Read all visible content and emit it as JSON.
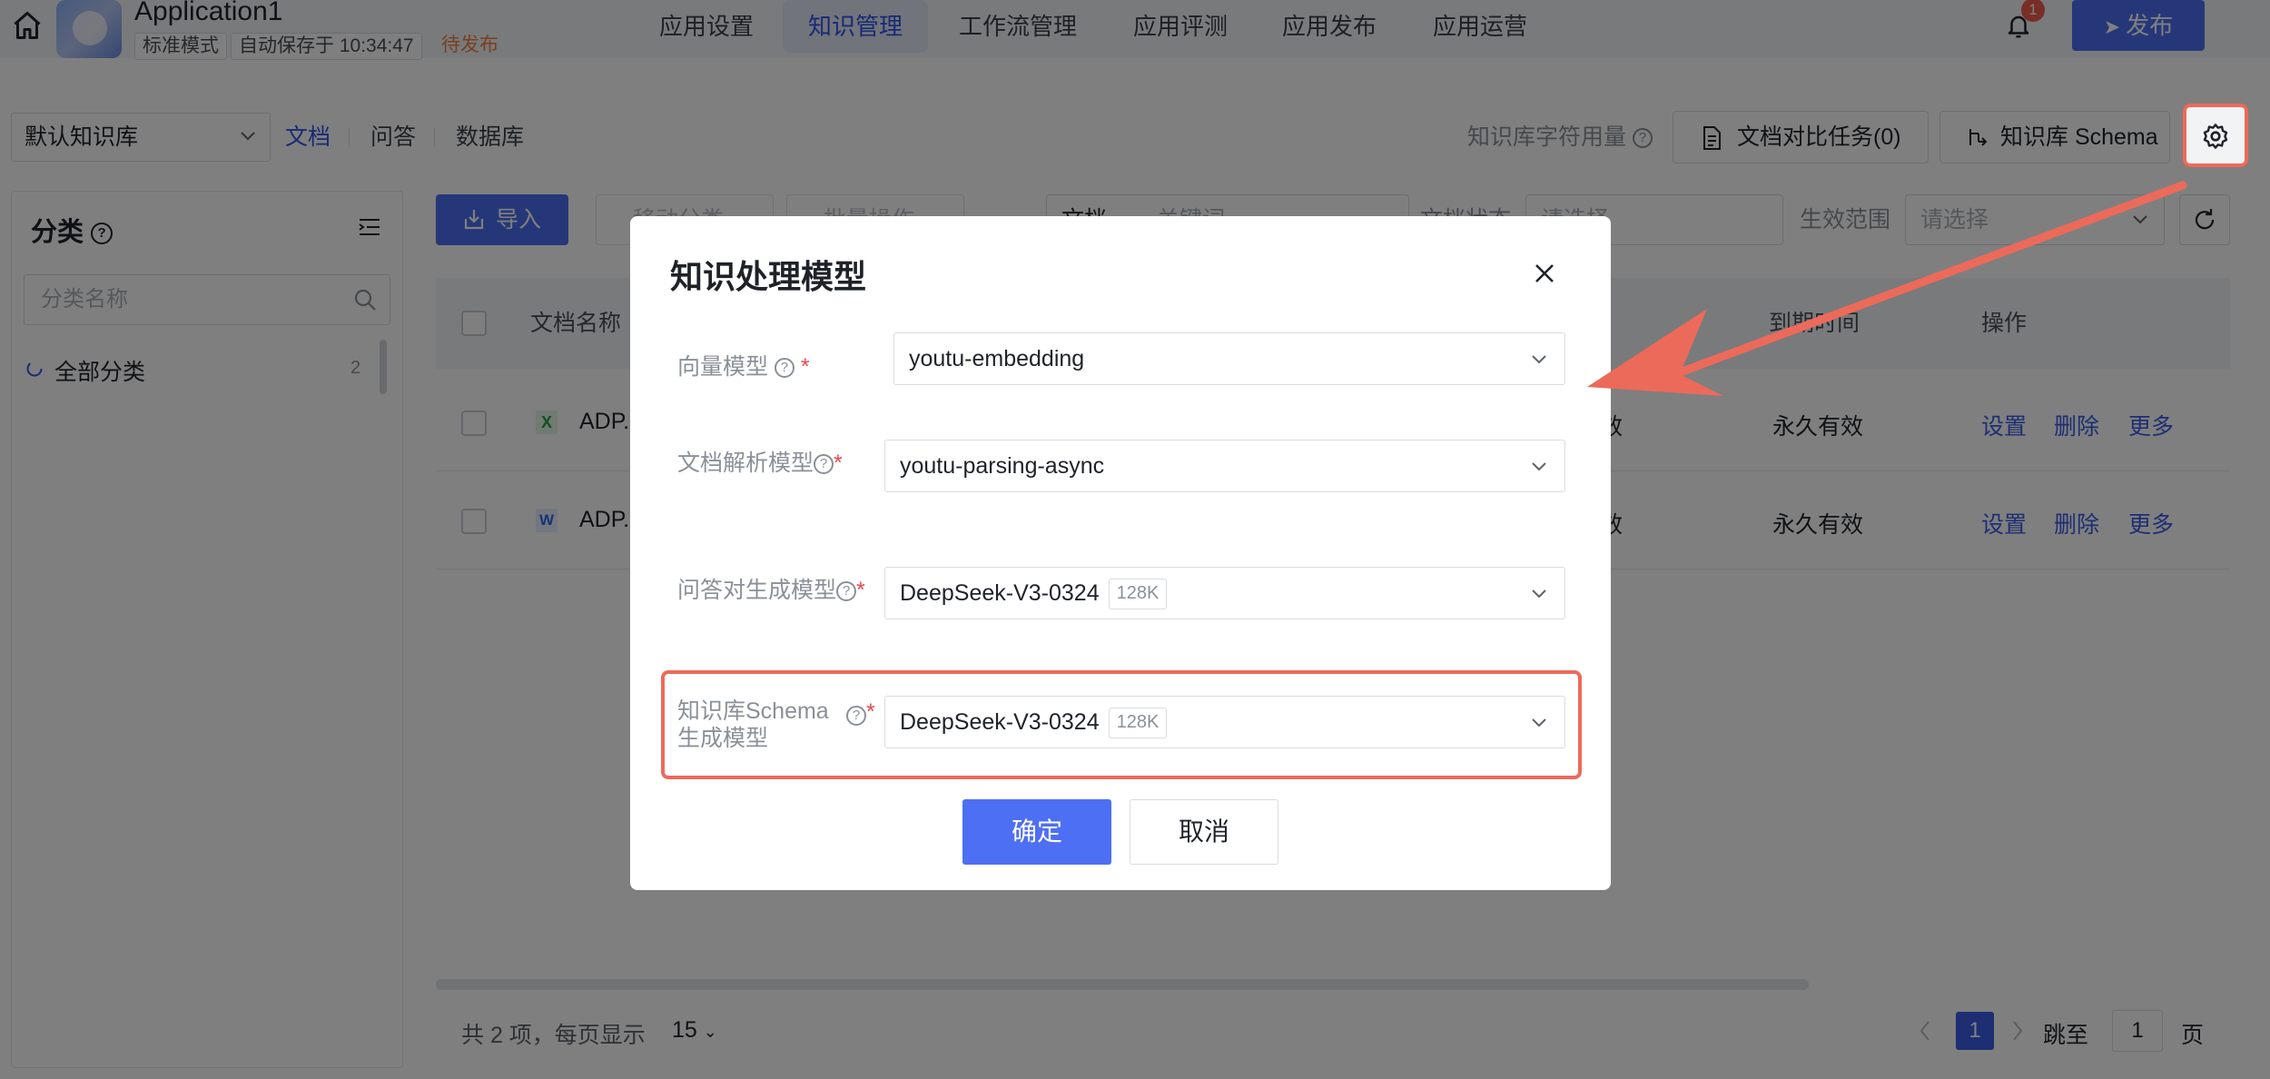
{
  "app": {
    "name": "Application1",
    "mode_tag": "标准模式",
    "autosave": "自动保存于 10:34:47",
    "publish_status": "待发布",
    "publish_label": "发布",
    "notification_count": "1"
  },
  "nav": {
    "tabs": [
      "应用设置",
      "知识管理",
      "工作流管理",
      "应用评测",
      "应用发布",
      "应用运营"
    ],
    "active": "知识管理"
  },
  "toolbar": {
    "kb_select": "默认知识库",
    "subtabs": [
      "文档",
      "问答",
      "数据库"
    ],
    "usage_label": "知识库字符用量",
    "compare_task": "文档对比任务(0)",
    "schema_button": "知识库 Schema"
  },
  "sidebar": {
    "title": "分类",
    "search_placeholder": "分类名称",
    "items": [
      {
        "label": "全部分类",
        "count": "2"
      }
    ]
  },
  "main": {
    "import_label": "导入",
    "move_label": "移动分类",
    "batch_label": "批量操作",
    "doc_filter": "文档",
    "keyword_placeholder": "关键词",
    "status_label": "文档状态",
    "status_placeholder": "请选择",
    "scope_label": "生效范围",
    "scope_placeholder": "请选择",
    "columns": [
      "文档名称",
      "到期时间",
      "操作"
    ],
    "rows": [
      {
        "name": "ADP.",
        "status_tail": "效",
        "expiry": "永久有效"
      },
      {
        "name": "ADP.",
        "status_tail": "效",
        "expiry": "永久有效"
      }
    ],
    "actions": [
      "设置",
      "删除",
      "更多"
    ]
  },
  "pagination": {
    "total_text": "共 2 项，每页显示",
    "page_size": "15",
    "current_page": "1",
    "jump_label": "跳至",
    "jump_value": "1",
    "page_suffix": "页"
  },
  "modal": {
    "title": "知识处理模型",
    "fields": [
      {
        "label": "向量模型",
        "value": "youtu-embedding",
        "tag": ""
      },
      {
        "label": "文档解析模型",
        "value": "youtu-parsing-async",
        "tag": ""
      },
      {
        "label": "问答对生成模型",
        "value": "DeepSeek-V3-0324",
        "tag": "128K"
      },
      {
        "label_line1": "知识库Schema",
        "label_line2": "生成模型",
        "value": "DeepSeek-V3-0324",
        "tag": "128K"
      }
    ],
    "ok_label": "确定",
    "cancel_label": "取消"
  },
  "colors": {
    "accent": "#4d6ff3",
    "highlight": "#ec6a5a",
    "required": "#e5484d"
  }
}
